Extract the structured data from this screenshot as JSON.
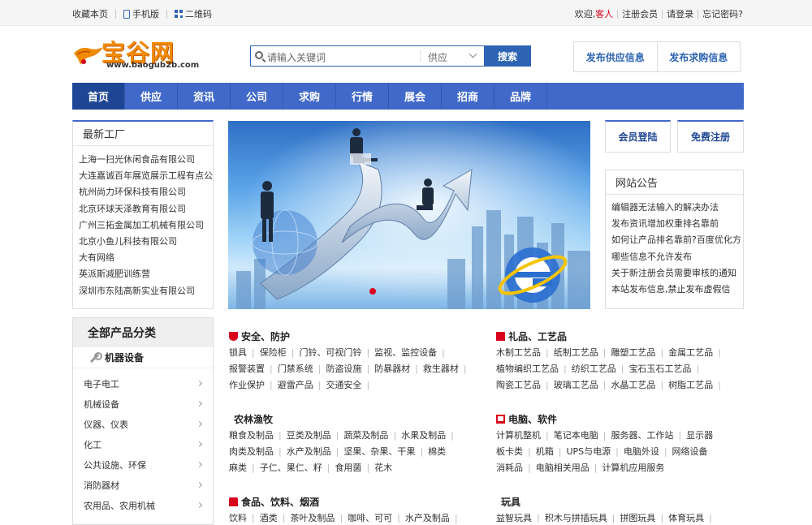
{
  "topbar": {
    "bookmark": "收藏本页",
    "mobile": "手机版",
    "qrcode": "二维码",
    "welcome": "欢迎,",
    "guest": "客人",
    "register": "注册会员",
    "login": "请登录",
    "forgot": "忘记密码?"
  },
  "logo": {
    "name": "宝谷网",
    "url": "www.baogub2b.com"
  },
  "search": {
    "placeholder": "请输入关键词",
    "type": "供应",
    "button": "搜索"
  },
  "publish": {
    "supply": "发布供应信息",
    "purchase": "发布求购信息"
  },
  "nav": [
    "首页",
    "供应",
    "资讯",
    "公司",
    "求购",
    "行情",
    "展会",
    "招商",
    "品牌"
  ],
  "factory": {
    "title": "最新工厂",
    "items": [
      "上海一扫光休闲食品有限公司",
      "大连嘉诚百年展览展示工程有点公",
      "杭州尚力环保科技有限公司",
      "北京环球天泽教育有限公司",
      "广州三拓金属加工机械有限公司",
      "北京小鱼儿科技有限公司",
      "大有网络",
      "英派斯减肥训练营",
      "深圳市东陆高新实业有限公司"
    ]
  },
  "member": {
    "login": "会员登陆",
    "register": "免费注册"
  },
  "notice": {
    "title": "网站公告",
    "items": [
      "编辑器无法输入的解决办法",
      "发布资讯增加权重排名靠前",
      "如何让产品排名靠前?百度优化方",
      "哪些信息不允许发布",
      "关于新注册会员需要审核的通知",
      "本站发布信息,禁止发布虚假信"
    ]
  },
  "categories": {
    "title": "全部产品分类",
    "sub": "机器设备",
    "items": [
      "电子电工",
      "机械设备",
      "仪器、仪表",
      "化工",
      "公共设施、环保",
      "消防器材",
      "农用品、农用机械"
    ]
  },
  "blocks": [
    {
      "title": "安全、防护",
      "icon": "shield-icon",
      "rows": [
        [
          "锁具",
          "保险柜",
          "门铃、可视门铃",
          "监视、监控设备"
        ],
        [
          "报警装置",
          "门禁系统",
          "防盗设施",
          "防暴器材",
          "救生器材"
        ],
        [
          "作业保护",
          "避雷产品",
          "交通安全"
        ]
      ]
    },
    {
      "title": "礼品、工艺品",
      "icon": "gift-icon",
      "rows": [
        [
          "木制工艺品",
          "纸制工艺品",
          "雕塑工艺品",
          "金属工艺品"
        ],
        [
          "植物编织工艺品",
          "纺织工艺品",
          "宝石玉石工艺品"
        ],
        [
          "陶瓷工艺品",
          "玻璃工艺品",
          "水晶工艺品",
          "树脂工艺品"
        ]
      ]
    },
    {
      "title": "农林渔牧",
      "icon": "",
      "rows": [
        [
          "粮食及制品",
          "豆类及制品",
          "蔬菜及制品",
          "水果及制品"
        ],
        [
          "肉类及制品",
          "水产及制品",
          "坚果、杂果、干果",
          "棉类"
        ],
        [
          "麻类",
          "子仁、果仁、籽",
          "食用菌",
          "花木"
        ]
      ]
    },
    {
      "title": "电脑、软件",
      "icon": "monitor-icon",
      "rows": [
        [
          "计算机整机",
          "笔记本电脑",
          "服务器、工作站",
          "显示器"
        ],
        [
          "板卡类",
          "机箱",
          "UPS与电源",
          "电脑外设",
          "网络设备"
        ],
        [
          "消耗品",
          "电脑相关用品",
          "计算机应用服务"
        ]
      ]
    },
    {
      "title": "食品、饮料、烟酒",
      "icon": "drink-icon",
      "rows": [
        [
          "饮料",
          "酒类",
          "茶叶及制品",
          "咖啡、可可",
          "水产及制品"
        ]
      ]
    },
    {
      "title": "玩具",
      "icon": "",
      "rows": [
        [
          "益智玩具",
          "积木与拼插玩具",
          "拼图玩具",
          "体育玩具"
        ]
      ]
    }
  ]
}
